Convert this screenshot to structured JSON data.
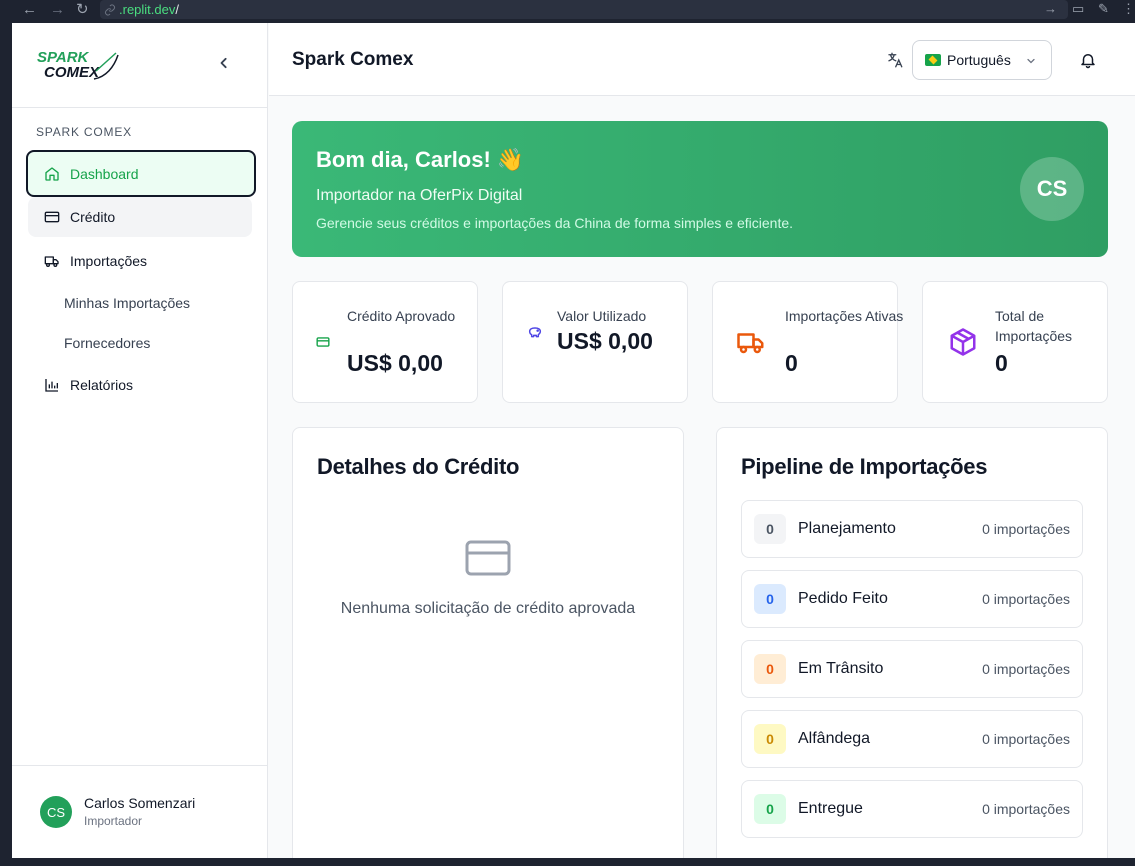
{
  "browser": {
    "url_host": ".replit.dev",
    "url_path": "/"
  },
  "sidebar": {
    "brand_line1": "SPARK",
    "brand_line2": "COMEX",
    "section_label": "SPARK COMEX",
    "items": [
      {
        "label": "Dashboard",
        "icon": "home-icon",
        "active": true
      },
      {
        "label": "Crédito",
        "icon": "credit-card-icon"
      },
      {
        "label": "Importações",
        "icon": "truck-icon"
      }
    ],
    "subitems": [
      {
        "label": "Minhas Importações"
      },
      {
        "label": "Fornecedores"
      }
    ],
    "reports": {
      "label": "Relatórios",
      "icon": "bar-chart-icon"
    },
    "user": {
      "initials": "CS",
      "name": "Carlos Somenzari",
      "role": "Importador"
    }
  },
  "header": {
    "title": "Spark Comex",
    "language": "Português"
  },
  "hero": {
    "greeting": "Bom dia, Carlos! 👋",
    "subtitle": "Importador na OferPix Digital",
    "description": "Gerencie seus créditos e importações da China de forma simples e eficiente.",
    "initials": "CS"
  },
  "stats": [
    {
      "label": "Crédito Aprovado",
      "value": "US$ 0,00",
      "icon": "credit-card-icon",
      "color": "#16a34a"
    },
    {
      "label": "Valor Utilizado",
      "value": "US$ 0,00",
      "icon": "piggy-bank-icon",
      "color": "#4f46e5"
    },
    {
      "label": "Importações Ativas",
      "value": "0",
      "icon": "truck-icon",
      "color": "#ea580c"
    },
    {
      "label": "Total de Importações",
      "value": "0",
      "icon": "package-icon",
      "color": "#9333ea"
    }
  ],
  "credit_panel": {
    "title": "Detalhes do Crédito",
    "empty_text": "Nenhuma solicitação de crédito aprovada"
  },
  "pipeline": {
    "title": "Pipeline de Importações",
    "stages": [
      {
        "count": "0",
        "name": "Planejamento",
        "summary": "0 importações",
        "bg": "#f3f4f6",
        "fg": "#4b5563"
      },
      {
        "count": "0",
        "name": "Pedido Feito",
        "summary": "0 importações",
        "bg": "#dbeafe",
        "fg": "#2563eb"
      },
      {
        "count": "0",
        "name": "Em Trânsito",
        "summary": "0 importações",
        "bg": "#ffedd5",
        "fg": "#ea580c"
      },
      {
        "count": "0",
        "name": "Alfândega",
        "summary": "0 importações",
        "bg": "#fef9c3",
        "fg": "#ca8a04"
      },
      {
        "count": "0",
        "name": "Entregue",
        "summary": "0 importações",
        "bg": "#dcfce7",
        "fg": "#16a34a"
      }
    ]
  }
}
